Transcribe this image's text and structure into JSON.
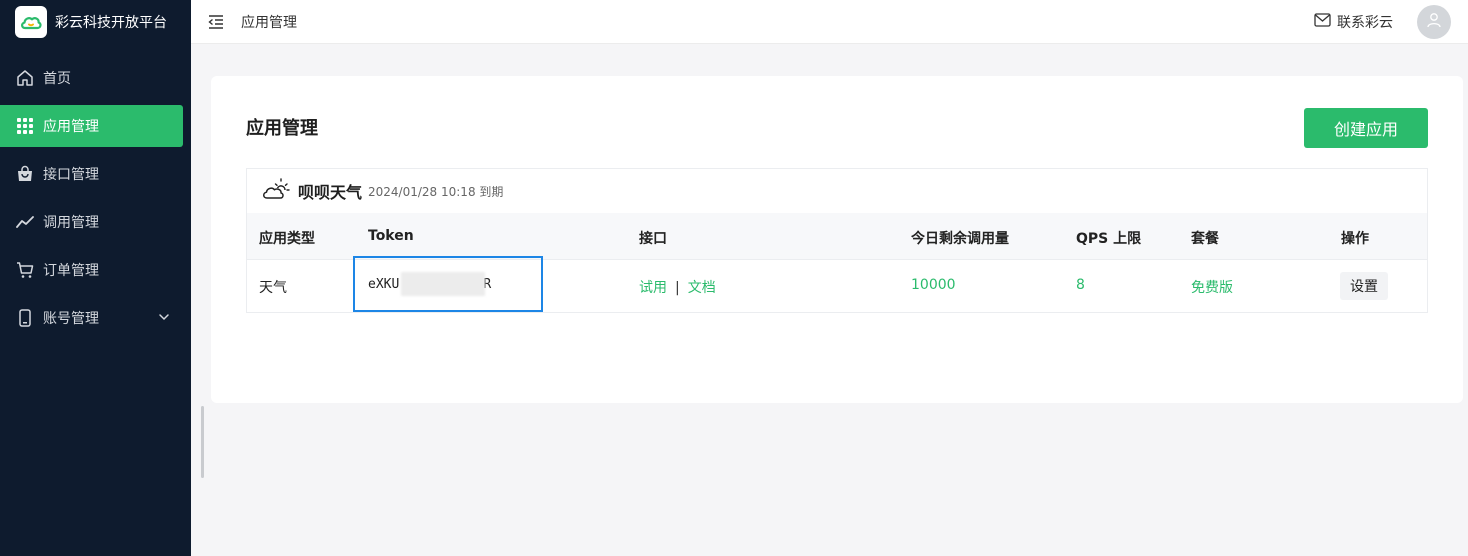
{
  "brand": {
    "name": "彩云科技开放平台",
    "logo_icon": "cloud-logo-icon",
    "accent": "#2bbb6c"
  },
  "sidebar": {
    "items": [
      {
        "label": "首页",
        "icon": "home-icon",
        "active": false
      },
      {
        "label": "应用管理",
        "icon": "grid-icon",
        "active": true
      },
      {
        "label": "接口管理",
        "icon": "bag-icon",
        "active": false
      },
      {
        "label": "调用管理",
        "icon": "trend-icon",
        "active": false
      },
      {
        "label": "订单管理",
        "icon": "cart-icon",
        "active": false
      },
      {
        "label": "账号管理",
        "icon": "phone-icon",
        "active": false,
        "expandable": true
      }
    ]
  },
  "header": {
    "breadcrumb": "应用管理",
    "contact_label": "联系彩云"
  },
  "main": {
    "title": "应用管理",
    "create_button": "创建应用",
    "app": {
      "name": "呗呗天气",
      "expiry": "2024/01/28 10:18 到期",
      "columns": [
        "应用类型",
        "Token",
        "接口",
        "今日剩余调用量",
        "QPS 上限",
        "套餐",
        "操作"
      ],
      "row": {
        "type": "天气",
        "token_prefix": "eXKU",
        "token_suffix": "R",
        "api_try": "试用",
        "api_sep": "|",
        "api_docs": "文档",
        "remaining_calls": "10000",
        "qps_limit": "8",
        "plan": "免费版",
        "action": "设置"
      }
    }
  }
}
